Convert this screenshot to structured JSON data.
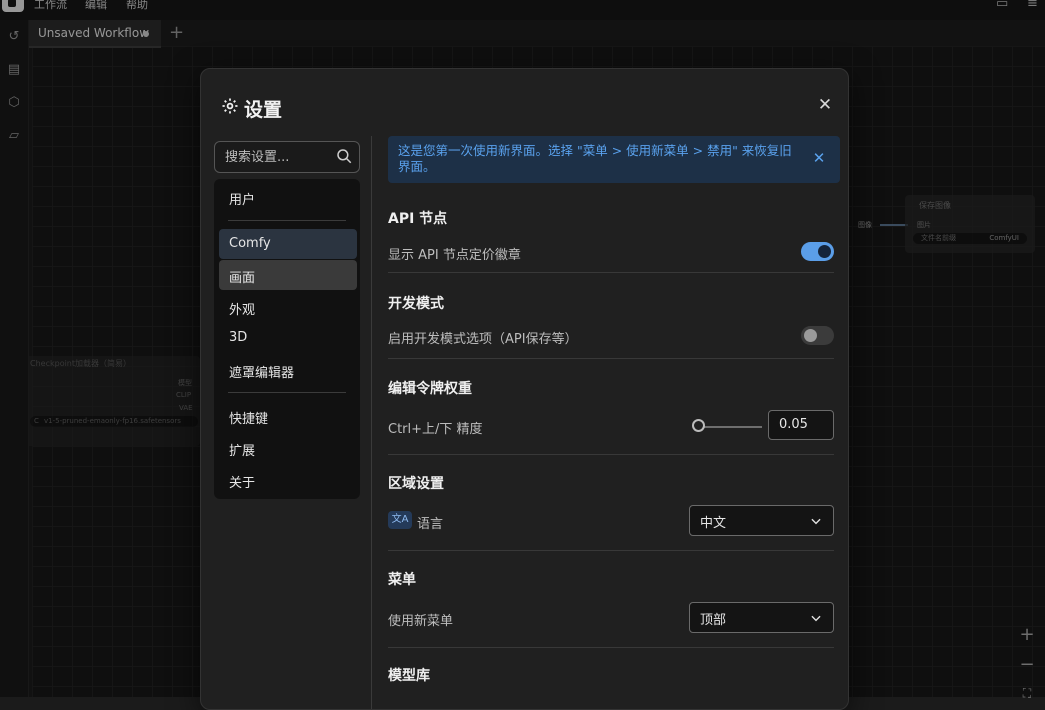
{
  "menubar": {
    "items": [
      "工作流",
      "编辑",
      "帮助"
    ]
  },
  "tabs": {
    "active_label": "Unsaved Workflow",
    "add_label": "+"
  },
  "background_nodes": {
    "left_title": "Checkpoint加载器（简易）",
    "left_outputs": [
      "模型",
      "CLIP",
      "VAE"
    ],
    "left_widget_prefix": "C",
    "left_widget_value": "v1-5-pruned-emaonly-fp16.safetensors",
    "right_title": "保存图像",
    "right_input": "图片",
    "right_widget_label": "文件名前缀",
    "right_widget_value": "ComfyUI",
    "link_label": "图像"
  },
  "zoom": {
    "plus": "+",
    "minus": "−"
  },
  "dialog": {
    "title": "设置",
    "search_placeholder": "搜索设置...",
    "nav": [
      "用户",
      "Comfy",
      "画面",
      "外观",
      "3D",
      "遮罩编辑器",
      "快捷键",
      "扩展",
      "关于"
    ],
    "banner": "这是您第一次使用新界面。选择 \"菜单 > 使用新菜单 > 禁用\" 来恢复旧界面。",
    "sections": {
      "api": {
        "title": "API 节点",
        "label": "显示 API 节点定价徽章",
        "enabled": true
      },
      "dev": {
        "title": "开发模式",
        "label": "启用开发模式选项（API保存等）",
        "enabled": false
      },
      "edit_token": {
        "title": "编辑令牌权重",
        "label": "Ctrl+上/下 精度",
        "value": "0.05"
      },
      "locale": {
        "title": "区域设置",
        "badge": "文A",
        "label": "语言",
        "value": "中文"
      },
      "menu": {
        "title": "菜单",
        "label": "使用新菜单",
        "value": "顶部"
      },
      "model_library": {
        "title": "模型库"
      }
    }
  }
}
